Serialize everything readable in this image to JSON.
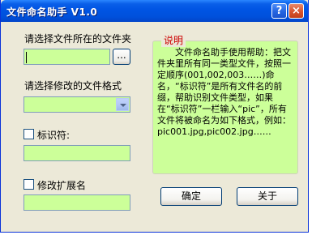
{
  "window": {
    "title": "文件命名助手 V1.0",
    "help_glyph": "?",
    "close_glyph": "×"
  },
  "folder": {
    "label": "请选择文件所在的文件夹",
    "value": "",
    "browse_label": "..."
  },
  "format": {
    "label": "请选择修改的文件格式",
    "selected": ""
  },
  "identifier": {
    "label": "标识符:",
    "checked": false,
    "value": ""
  },
  "extension": {
    "label": "修改扩展名",
    "checked": false,
    "value": ""
  },
  "help": {
    "title": "说明",
    "text": "　　文件命名助手使用帮助：把文件夹里所有同一类型文件，按照一定顺序(001,002,003……)命名，“标识符”是所有文件名的前缀，帮助识别文件类型，如果在“标识符”一栏输入“pic”，所有文件将被命名为如下格式，例如：pic001.jpg,pic002.jpg……"
  },
  "buttons": {
    "ok": "确定",
    "close": "关于"
  },
  "colors": {
    "field_bg": "#ccff99",
    "help_title": "#cc0000",
    "titlebar": "#0054e3",
    "window_bg": "#ece9d8"
  }
}
